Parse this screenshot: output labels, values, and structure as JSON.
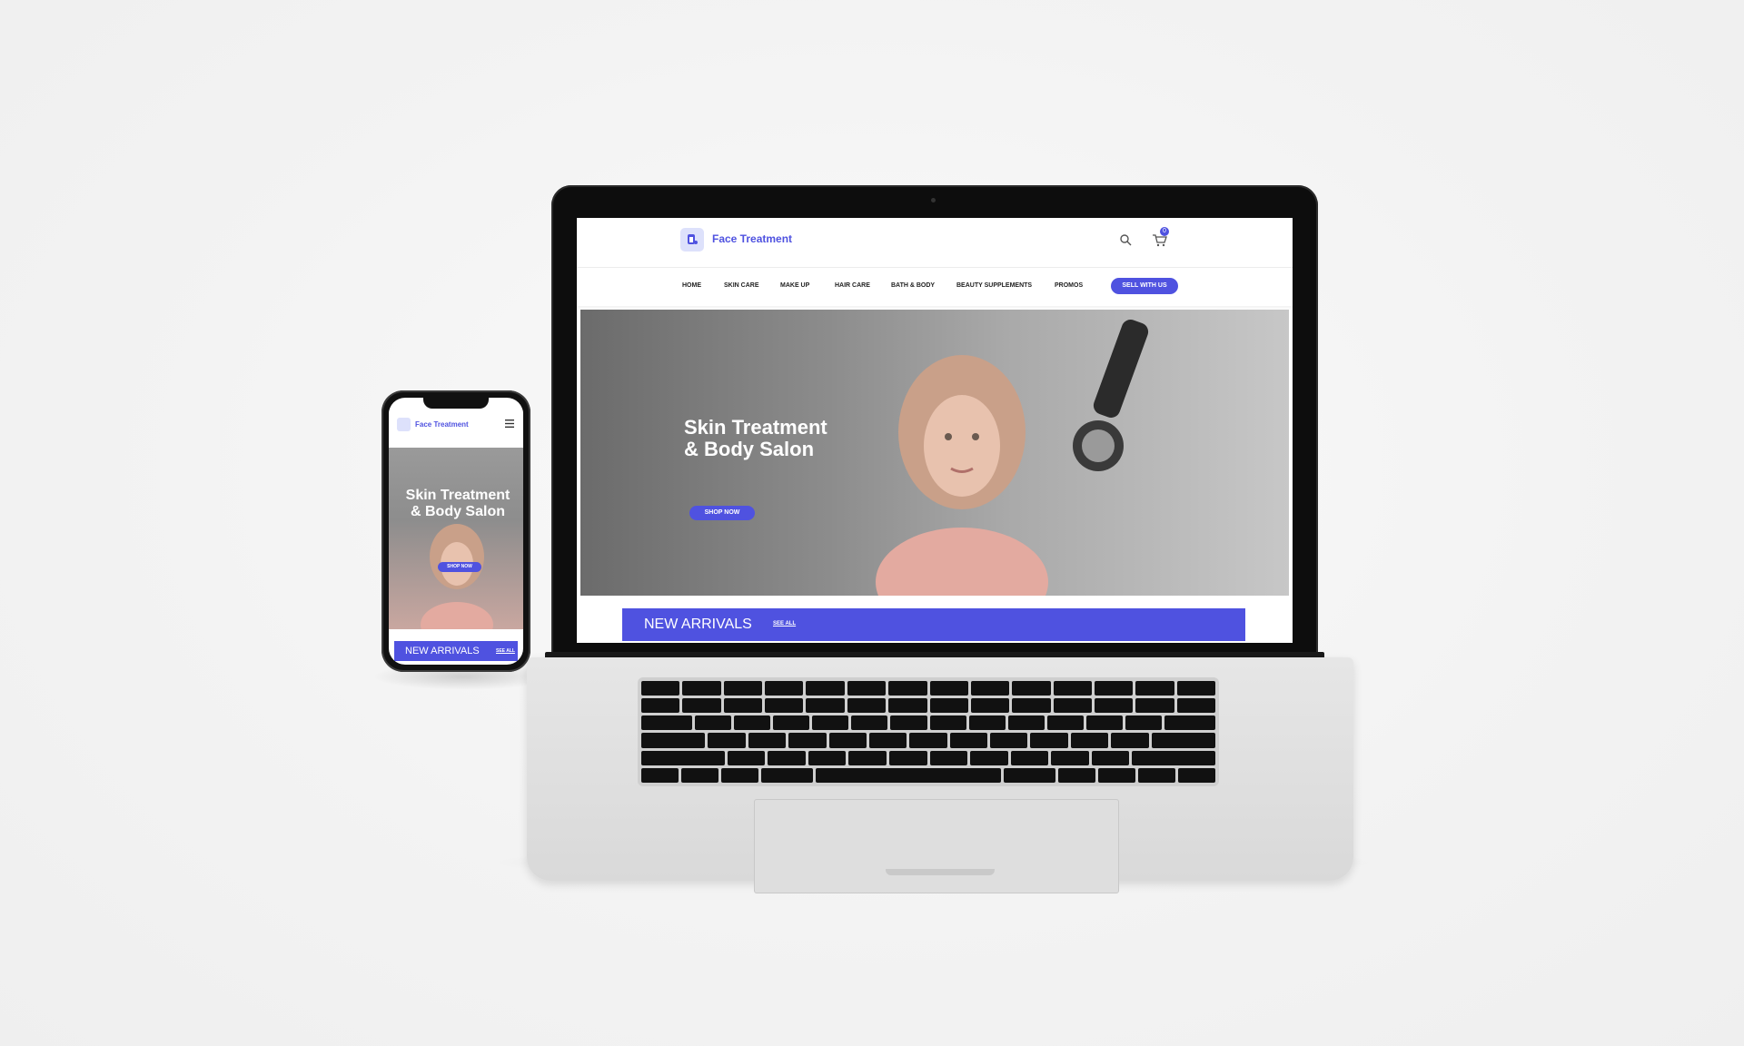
{
  "brand": {
    "name": "Face Treatment",
    "accent": "#4f52e0"
  },
  "header": {
    "cart_count": "0"
  },
  "nav": {
    "items": [
      "HOME",
      "SKIN CARE",
      "MAKE UP",
      "HAIR CARE",
      "BATH & BODY",
      "BEAUTY SUPPLEMENTS",
      "PROMOS"
    ],
    "cta": "SELL WITH US"
  },
  "hero": {
    "title_line1": "Skin Treatment",
    "title_line2": "& Body Salon",
    "button": "SHOP NOW"
  },
  "arrivals": {
    "title": "NEW ARRIVALS",
    "see_all": "SEE ALL"
  },
  "icons": [
    "logo-icon",
    "search-icon",
    "cart-icon",
    "hamburger-menu-icon"
  ]
}
